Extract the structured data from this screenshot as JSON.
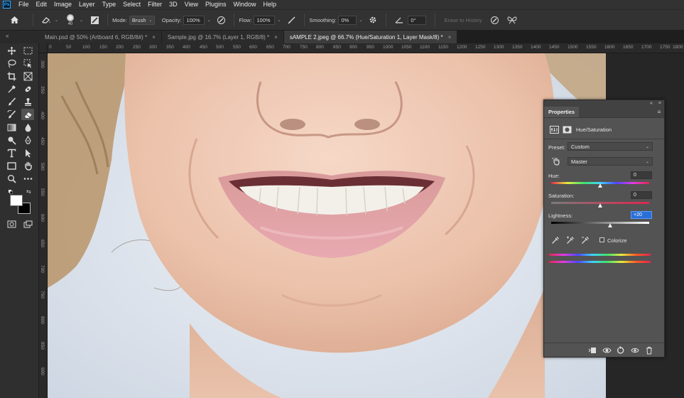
{
  "app": {
    "logo": "Ps",
    "menu": [
      "File",
      "Edit",
      "Image",
      "Layer",
      "Type",
      "Select",
      "Filter",
      "3D",
      "View",
      "Plugins",
      "Window",
      "Help"
    ]
  },
  "options_bar": {
    "brush_size": "40",
    "mode_label": "Mode:",
    "mode_value": "Brush",
    "opacity_label": "Opacity:",
    "opacity_value": "100%",
    "flow_label": "Flow:",
    "flow_value": "100%",
    "smoothing_label": "Smoothing:",
    "smoothing_value": "0%",
    "angle_value": "0°",
    "erase_to_history": "Erase to History"
  },
  "tabs": [
    {
      "label": "Main.psd @ 50% (Artboard 6, RGB/8#) *",
      "active": false
    },
    {
      "label": "Sample.jpg @ 16.7% (Layer 1, RGB/8) *",
      "active": false
    },
    {
      "label": "sAMPLE 2.jpeg @ 66.7% (Hue/Saturation 1, Layer Mask/8) *",
      "active": true
    }
  ],
  "ruler": {
    "top_ticks": [
      "0",
      "50",
      "100",
      "150",
      "200",
      "250",
      "300",
      "350",
      "400",
      "450",
      "500",
      "550",
      "600",
      "650",
      "700",
      "750",
      "800",
      "850",
      "900",
      "950",
      "1000",
      "1050",
      "1100",
      "1150",
      "1200",
      "1250",
      "1300",
      "1350",
      "1400",
      "1450",
      "1500",
      "1550",
      "1600",
      "1650",
      "1700",
      "1750",
      "1800"
    ],
    "left_ticks": [
      "300",
      "350",
      "400",
      "450",
      "500",
      "550",
      "600",
      "650",
      "700",
      "750",
      "800",
      "850",
      "900"
    ]
  },
  "properties": {
    "tab_label": "Properties",
    "adjustment_title": "Hue/Saturation",
    "preset_label": "Preset:",
    "preset_value": "Custom",
    "channel_value": "Master",
    "hue_label": "Hue:",
    "hue_value": "0",
    "saturation_label": "Saturation:",
    "saturation_value": "0",
    "lightness_label": "Lightness:",
    "lightness_value": "+20",
    "colorize_label": "Colorize",
    "hue_slider_fraction": 0.5,
    "saturation_slider_fraction": 0.5,
    "lightness_slider_fraction": 0.6
  },
  "colors": {
    "foreground": "#ffffff",
    "background": "#000000",
    "accent": "#2a6fd6"
  }
}
